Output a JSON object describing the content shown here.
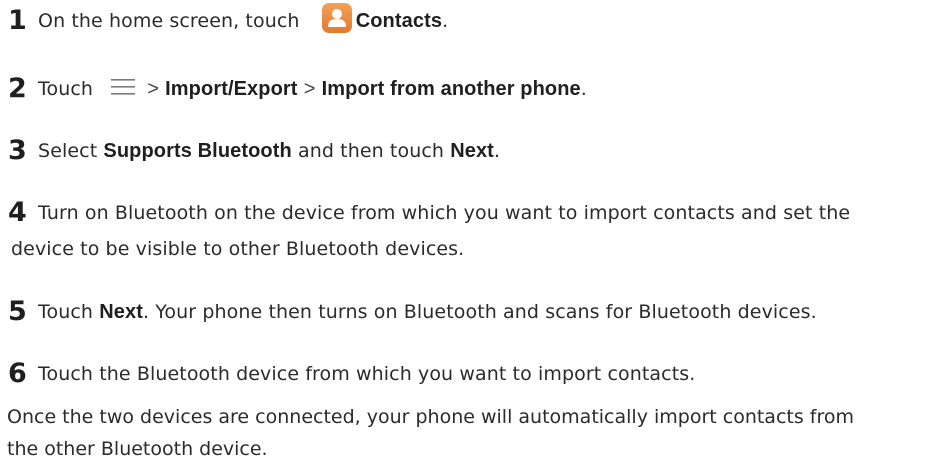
{
  "steps": [
    {
      "number": "1",
      "text_before": "On the home screen, touch",
      "icon": "contacts-app-icon",
      "bold": "Contacts",
      "text_after": "."
    },
    {
      "number": "2",
      "text_before": "Touch",
      "icon": "menu-icon",
      "separator": ">",
      "bold_1": "Import/Export",
      "bold_2": "Import from another phone",
      "text_after": "."
    },
    {
      "number": "3",
      "text_1": "Select",
      "bold_1": "Supports Bluetooth",
      "text_2": "and then touch",
      "bold_2": "Next",
      "text_after": "."
    },
    {
      "number": "4",
      "line_1": "Turn on Bluetooth on the device from which you want to import contacts and set the",
      "line_2": "device to be visible to other Bluetooth devices."
    },
    {
      "number": "5",
      "text_before": "Touch",
      "bold": "Next",
      "text_after": ". Your phone then turns on Bluetooth and scans for Bluetooth devices."
    },
    {
      "number": "6",
      "text": "Touch the Bluetooth device from which you want to import contacts."
    }
  ],
  "note": {
    "line_1": "Once the two devices are connected, your phone will automatically import contacts from",
    "line_2": "the other Bluetooth device."
  },
  "colors": {
    "icon_orange": "#e8873a",
    "text": "#2b2b2b"
  }
}
